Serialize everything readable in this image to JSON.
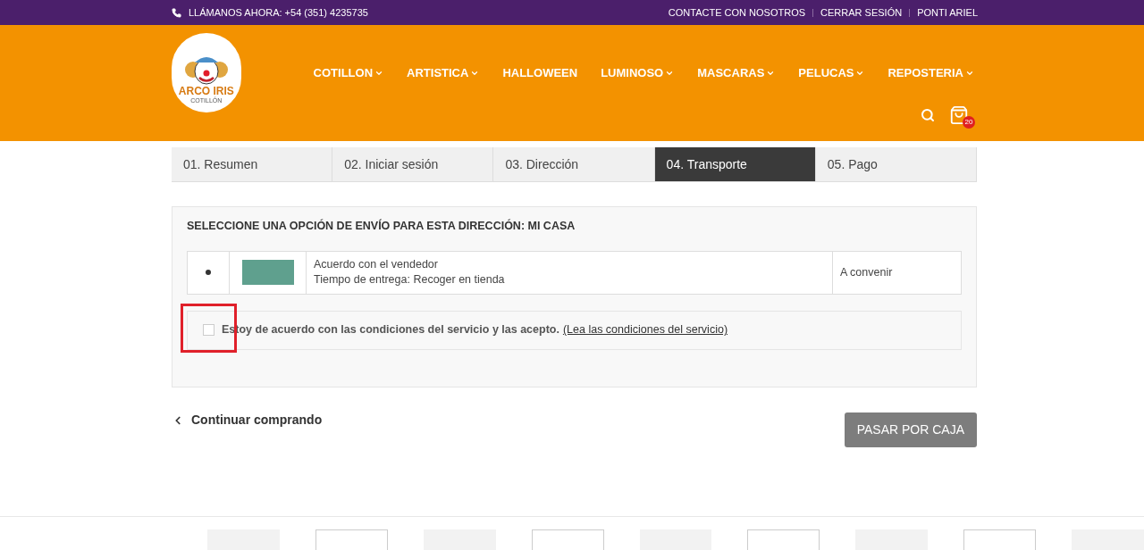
{
  "top_bar": {
    "phone": "LLÁMANOS AHORA: +54 (351) 4235735",
    "links": [
      "CONTACTE CON NOSOTROS",
      "CERRAR SESIÓN",
      "PONTI ARIEL"
    ]
  },
  "logo": {
    "name": "ARCO IRIS",
    "tagline": "COTILLÓN"
  },
  "nav": [
    {
      "label": "COTILLON",
      "dropdown": true
    },
    {
      "label": "ARTISTICA",
      "dropdown": true
    },
    {
      "label": "HALLOWEEN",
      "dropdown": false
    },
    {
      "label": "LUMINOSO",
      "dropdown": true
    },
    {
      "label": "MASCARAS",
      "dropdown": true
    },
    {
      "label": "PELUCAS",
      "dropdown": true
    },
    {
      "label": "REPOSTERIA",
      "dropdown": true
    }
  ],
  "cart": {
    "count": "20"
  },
  "steps": [
    {
      "label": "01. Resumen",
      "selected": false
    },
    {
      "label": "02. Iniciar sesión",
      "selected": false
    },
    {
      "label": "03. Dirección",
      "selected": false
    },
    {
      "label": "04. Transporte",
      "selected": true
    },
    {
      "label": "05. Pago",
      "selected": false
    }
  ],
  "shipping": {
    "heading": "SELECCIONE UNA OPCIÓN DE ENVÍO PARA ESTA DIRECCIÓN: MI CASA",
    "options": [
      {
        "selected": true,
        "name": "Acuerdo con el vendedor",
        "delivery": "Tiempo de entrega: Recoger en tienda",
        "price": "A convenir"
      }
    ],
    "terms": {
      "checked": false,
      "text": "Estoy de acuerdo con las condiciones del servicio y las acepto.",
      "link": "(Lea las condiciones del servicio)"
    }
  },
  "continue_link": "Continuar comprando",
  "checkout_button": "PASAR POR CAJA"
}
